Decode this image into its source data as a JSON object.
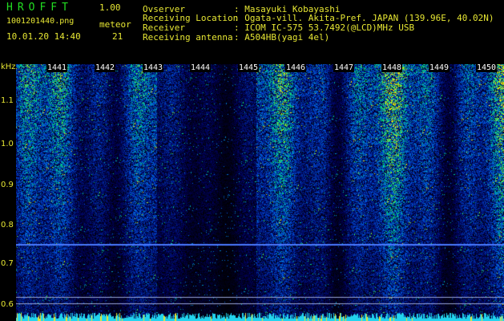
{
  "header": {
    "app_title": "HROFFT",
    "app_version": "1.00",
    "file_name": "1001201440.png",
    "meteor_label": "meteor",
    "date_time": "10.01.20 14:40",
    "meteor_count": "21",
    "fields": [
      {
        "label": "Ovserver",
        "value": ": Masayuki Kobayashi"
      },
      {
        "label": "Receiving Location",
        "value": ": Ogata-vill. Akita-Pref. JAPAN (139.96E, 40.02N)"
      },
      {
        "label": "Receiver",
        "value": ": ICOM IC-575 53.7492(@LCD)MHz USB"
      },
      {
        "label": "Receiving antenna",
        "value": ": A504HB(yagi 4el)"
      }
    ]
  },
  "spectrogram": {
    "y_unit": "kHz",
    "y_ticks": [
      "1.1",
      "1.0",
      "0.9",
      "0.8",
      "0.7",
      "0.6"
    ],
    "minute_labels": [
      "1441",
      "1442",
      "1443",
      "1444",
      "1445",
      "1446",
      "1447",
      "1448",
      "1449",
      "1450"
    ],
    "colors": {
      "text": "#e6e633",
      "title": "#22dd22"
    }
  }
}
